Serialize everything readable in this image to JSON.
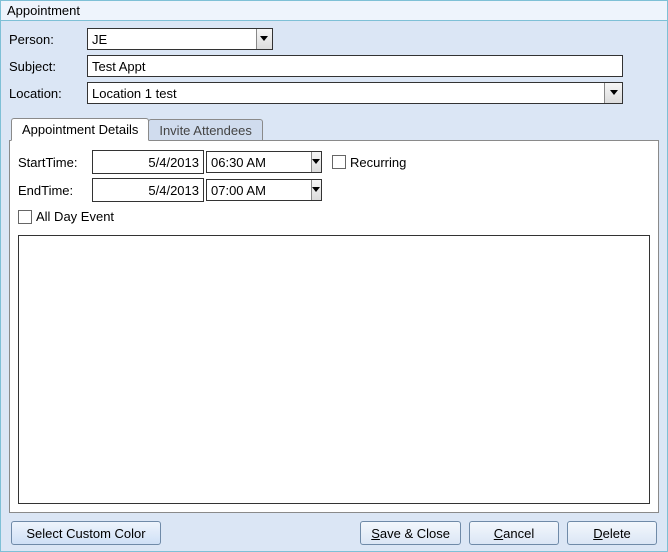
{
  "window": {
    "title": "Appointment"
  },
  "header": {
    "person_label": "Person:",
    "person_value": "JE",
    "subject_label": "Subject:",
    "subject_value": "Test Appt",
    "location_label": "Location:",
    "location_value": "Location 1 test"
  },
  "tabs": {
    "details": "Appointment Details",
    "invite": "Invite Attendees",
    "active_index": 0
  },
  "details": {
    "start_label": "StartTime:",
    "start_date": "5/4/2013",
    "start_time": "06:30 AM",
    "end_label": "EndTime:",
    "end_date": "5/4/2013",
    "end_time": "07:00 AM",
    "recurring_label": "Recurring",
    "recurring_checked": false,
    "allday_label": "All Day Event",
    "allday_checked": false,
    "notes": ""
  },
  "buttons": {
    "custom_color": "Select Custom Color",
    "save_close_pre": "",
    "save_close_key": "S",
    "save_close_post": "ave & Close",
    "cancel_pre": "",
    "cancel_key": "C",
    "cancel_post": "ancel",
    "delete_pre": "",
    "delete_key": "D",
    "delete_post": "elete"
  }
}
